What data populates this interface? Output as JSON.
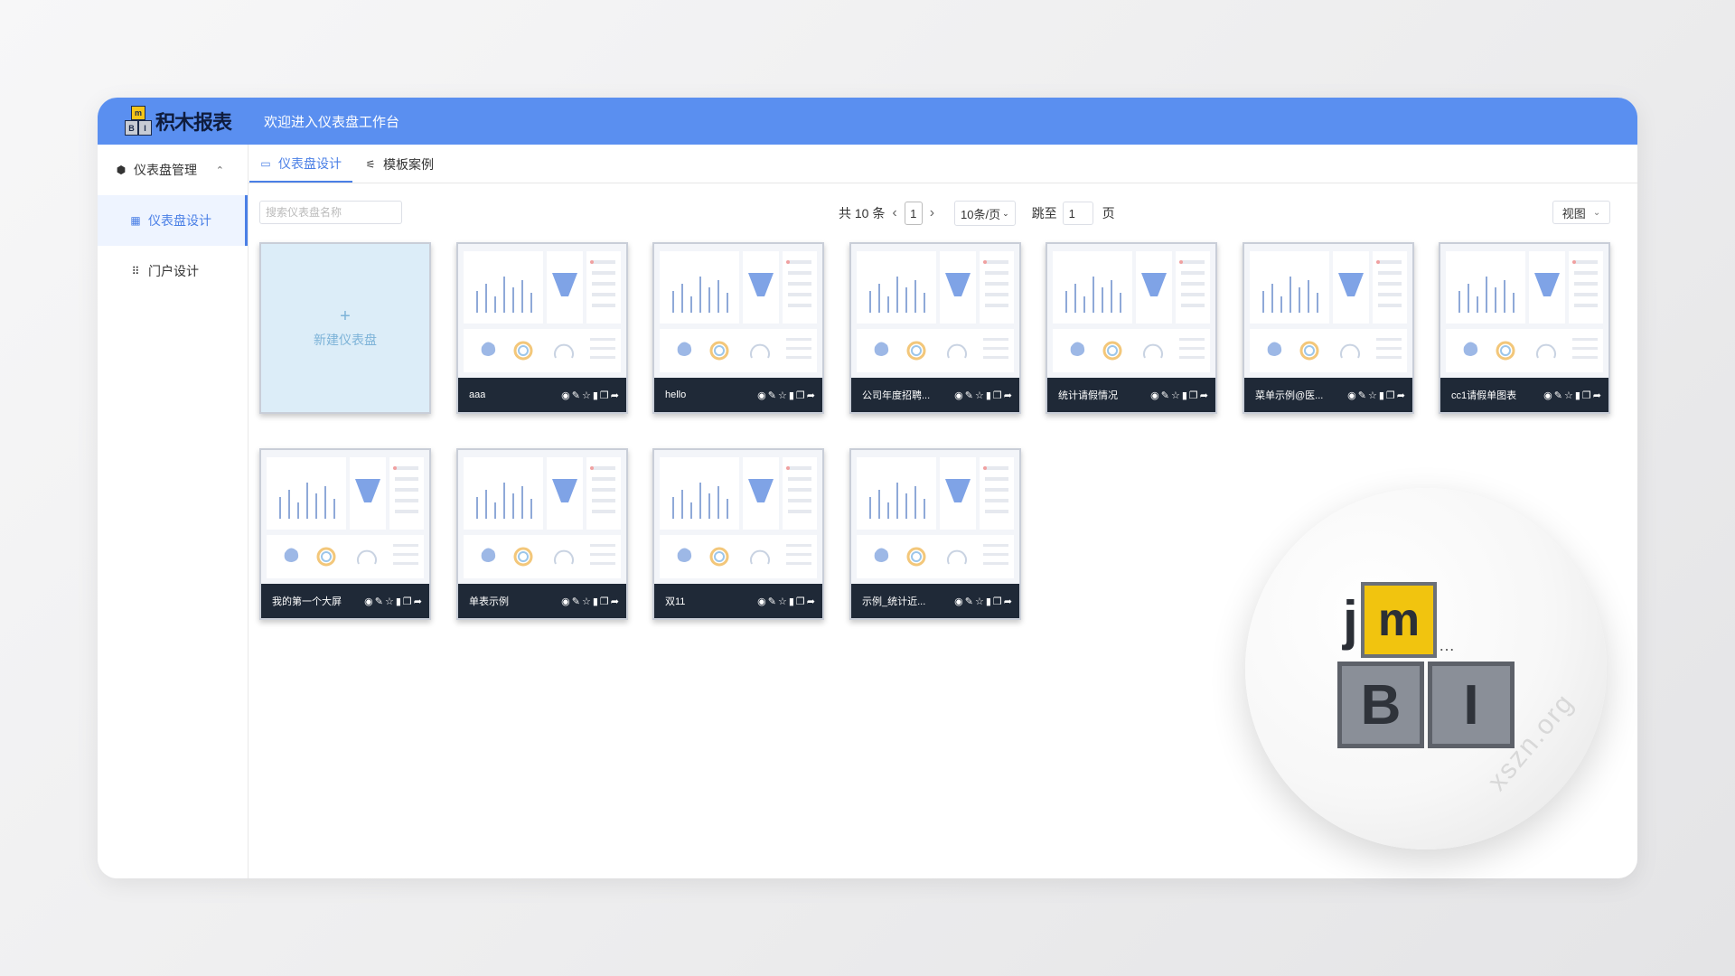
{
  "header": {
    "logo_text": "积木报表",
    "logo_blocks": [
      "m",
      "B",
      "I"
    ],
    "welcome": "欢迎进入仪表盘工作台",
    "bar_color": "#5a8ff0"
  },
  "sidebar": {
    "group_label": "仪表盘管理",
    "group_icon": "cube-icon",
    "items": [
      {
        "label": "仪表盘设计",
        "icon": "grid-icon",
        "active": true
      },
      {
        "label": "门户设计",
        "icon": "dots-grid-icon",
        "active": false
      }
    ]
  },
  "tabs": [
    {
      "label": "仪表盘设计",
      "icon": "monitor-icon",
      "active": true
    },
    {
      "label": "模板案例",
      "icon": "sliders-icon",
      "active": false
    }
  ],
  "toolbar": {
    "search_placeholder": "搜索仪表盘名称",
    "total": "共 10 条",
    "current_page": "1",
    "page_size": "10条/页",
    "jump_label": "跳至",
    "jump_value": "1",
    "page_word": "页",
    "view_label": "视图"
  },
  "new_card": {
    "plus": "+",
    "label": "新建仪表盘"
  },
  "cards": [
    {
      "title": "aaa"
    },
    {
      "title": "hello"
    },
    {
      "title": "公司年度招聘..."
    },
    {
      "title": "统计请假情况"
    },
    {
      "title": "菜单示例@医..."
    },
    {
      "title": "cc1请假单图表"
    },
    {
      "title": "我的第一个大屏"
    },
    {
      "title": "单表示例"
    },
    {
      "title": "双11"
    },
    {
      "title": "示例_统计近..."
    }
  ],
  "card_actions": [
    "eye-icon",
    "pencil-icon",
    "star-icon",
    "trash-icon",
    "copy-icon",
    "share-icon"
  ],
  "watermark": "xszn.org",
  "accent_color": "#4a7fe6"
}
